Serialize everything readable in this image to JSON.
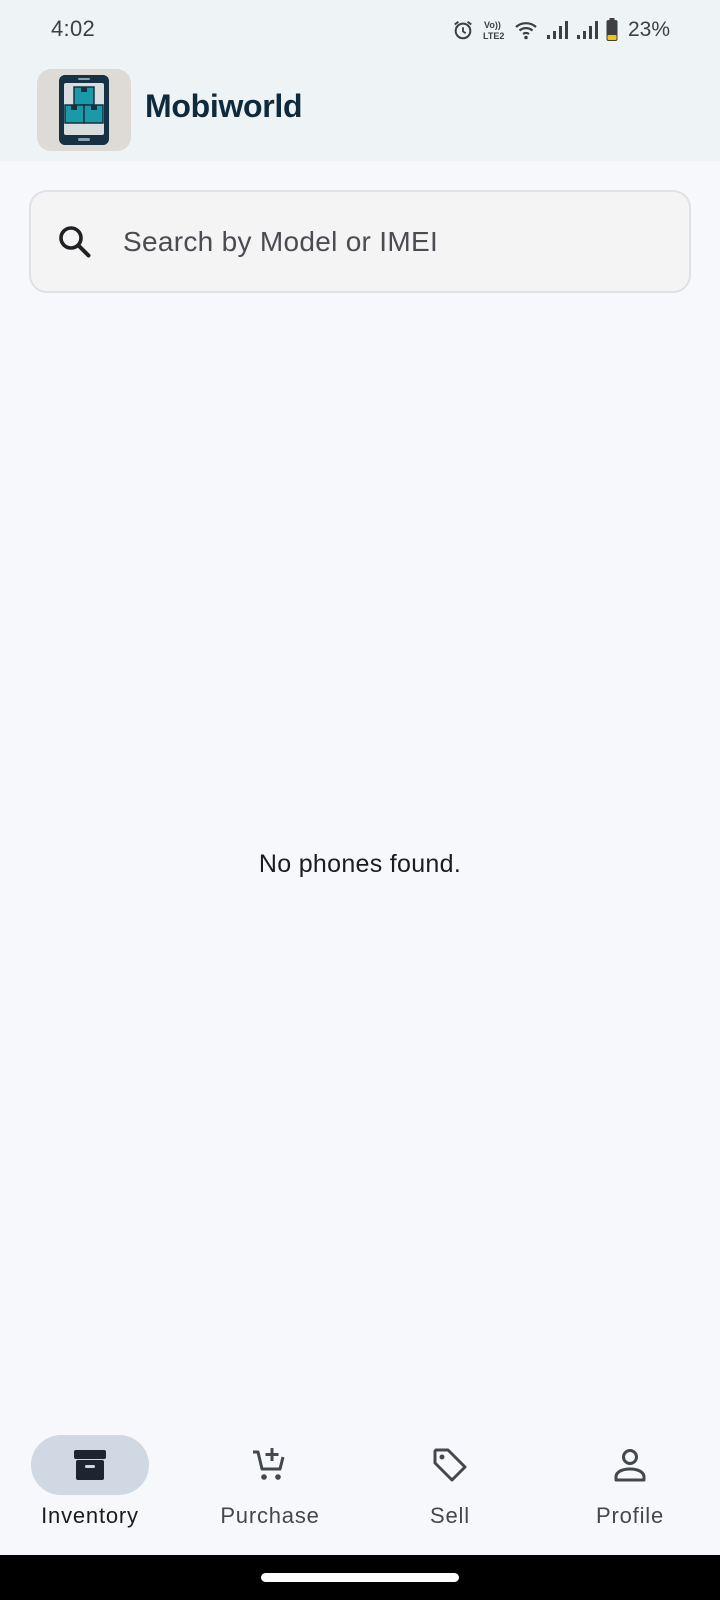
{
  "status_bar": {
    "time": "4:02",
    "battery_percent": "23%",
    "icons": [
      "alarm-icon",
      "volte-lte2-icon",
      "wifi-icon",
      "signal-icon",
      "signal-icon",
      "battery-icon"
    ]
  },
  "app_bar": {
    "title": "Mobiworld",
    "logo_icon": "phone-boxes-logo"
  },
  "search": {
    "placeholder": "Search by Model or IMEI",
    "value": ""
  },
  "main": {
    "empty_message": "No phones found."
  },
  "bottom_nav": {
    "active_index": 0,
    "items": [
      {
        "label": "Inventory",
        "icon": "archive-box-icon"
      },
      {
        "label": "Purchase",
        "icon": "cart-plus-icon"
      },
      {
        "label": "Sell",
        "icon": "tag-icon"
      },
      {
        "label": "Profile",
        "icon": "person-icon"
      }
    ]
  },
  "colors": {
    "background": "#f6f8fc",
    "top_bar": "#eef3f6",
    "title": "#0f2a3c",
    "active_pill": "#cfd8e3",
    "logo_teal": "#1a9aa6"
  }
}
